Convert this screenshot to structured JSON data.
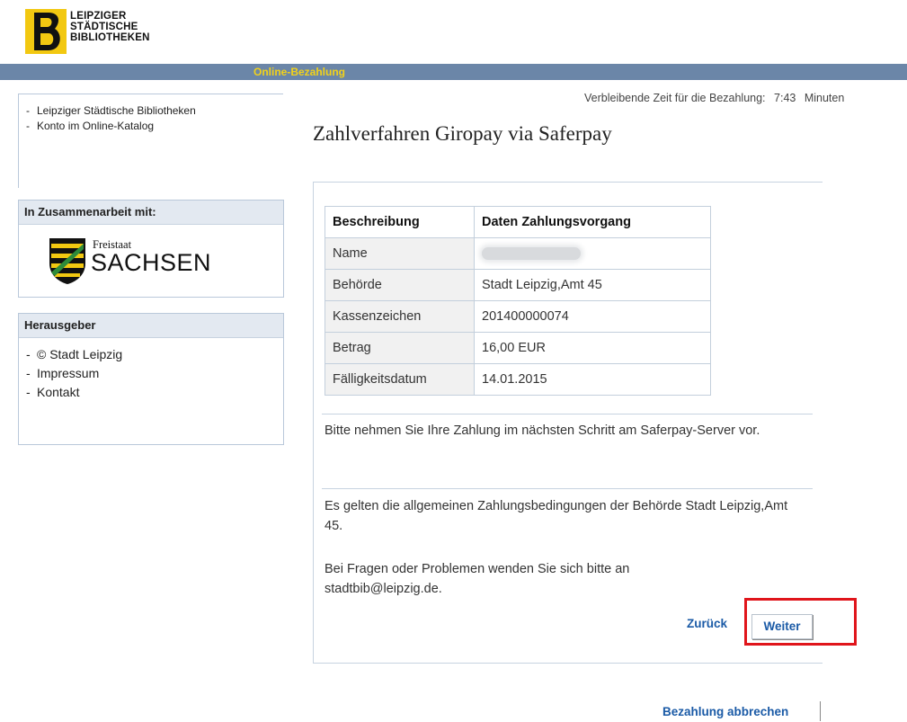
{
  "header": {
    "logo_lines": [
      "LEIPZIGER",
      "STÄDTISCHE",
      "BIBLIOTHEKEN"
    ],
    "banner_title": "Online-Bezahlung"
  },
  "sidebar": {
    "links": [
      {
        "label": "Leipziger Städtische Bibliotheken"
      },
      {
        "label": "Konto im Online-Katalog"
      }
    ],
    "partner": {
      "heading": "In Zusammenarbeit mit:",
      "logo_small": "Freistaat",
      "logo_big": "SACHSEN"
    },
    "publisher": {
      "heading": "Herausgeber",
      "links": [
        {
          "label": "© Stadt Leipzig"
        },
        {
          "label": "Impressum"
        },
        {
          "label": "Kontakt"
        }
      ]
    }
  },
  "main": {
    "timer_label": "Verbleibende Zeit für die Bezahlung:",
    "timer_value": "7:43",
    "timer_unit": "Minuten",
    "title": "Zahlverfahren Giropay via Saferpay",
    "table": {
      "headers": [
        "Beschreibung",
        "Daten Zahlungsvorgang"
      ],
      "rows": [
        {
          "key": "Name",
          "value": ""
        },
        {
          "key": "Behörde",
          "value": "Stadt Leipzig,Amt 45"
        },
        {
          "key": "Kassenzeichen",
          "value": "201400000074"
        },
        {
          "key": "Betrag",
          "value": "16,00 EUR"
        },
        {
          "key": "Fälligkeitsdatum",
          "value": "14.01.2015"
        }
      ]
    },
    "info_1": "Bitte nehmen Sie Ihre Zahlung im nächsten Schritt am Saferpay-Server vor.",
    "info_2": "Es gelten die allgemeinen Zahlungsbedingungen der Behörde Stadt Leipzig,Amt 45.",
    "info_3": "Bei Fragen oder Problemen wenden Sie sich bitte an stadtbib@leipzig.de.",
    "back_label": "Zurück",
    "next_label": "Weiter",
    "cancel_label": "Bezahlung abbrechen"
  },
  "colors": {
    "banner": "#6b86a8",
    "banner_text": "#f2d21a",
    "link": "#1a5aa6",
    "highlight": "#e0151b"
  },
  "icons": [
    "library-logo",
    "sachsen-coat-of-arms"
  ]
}
